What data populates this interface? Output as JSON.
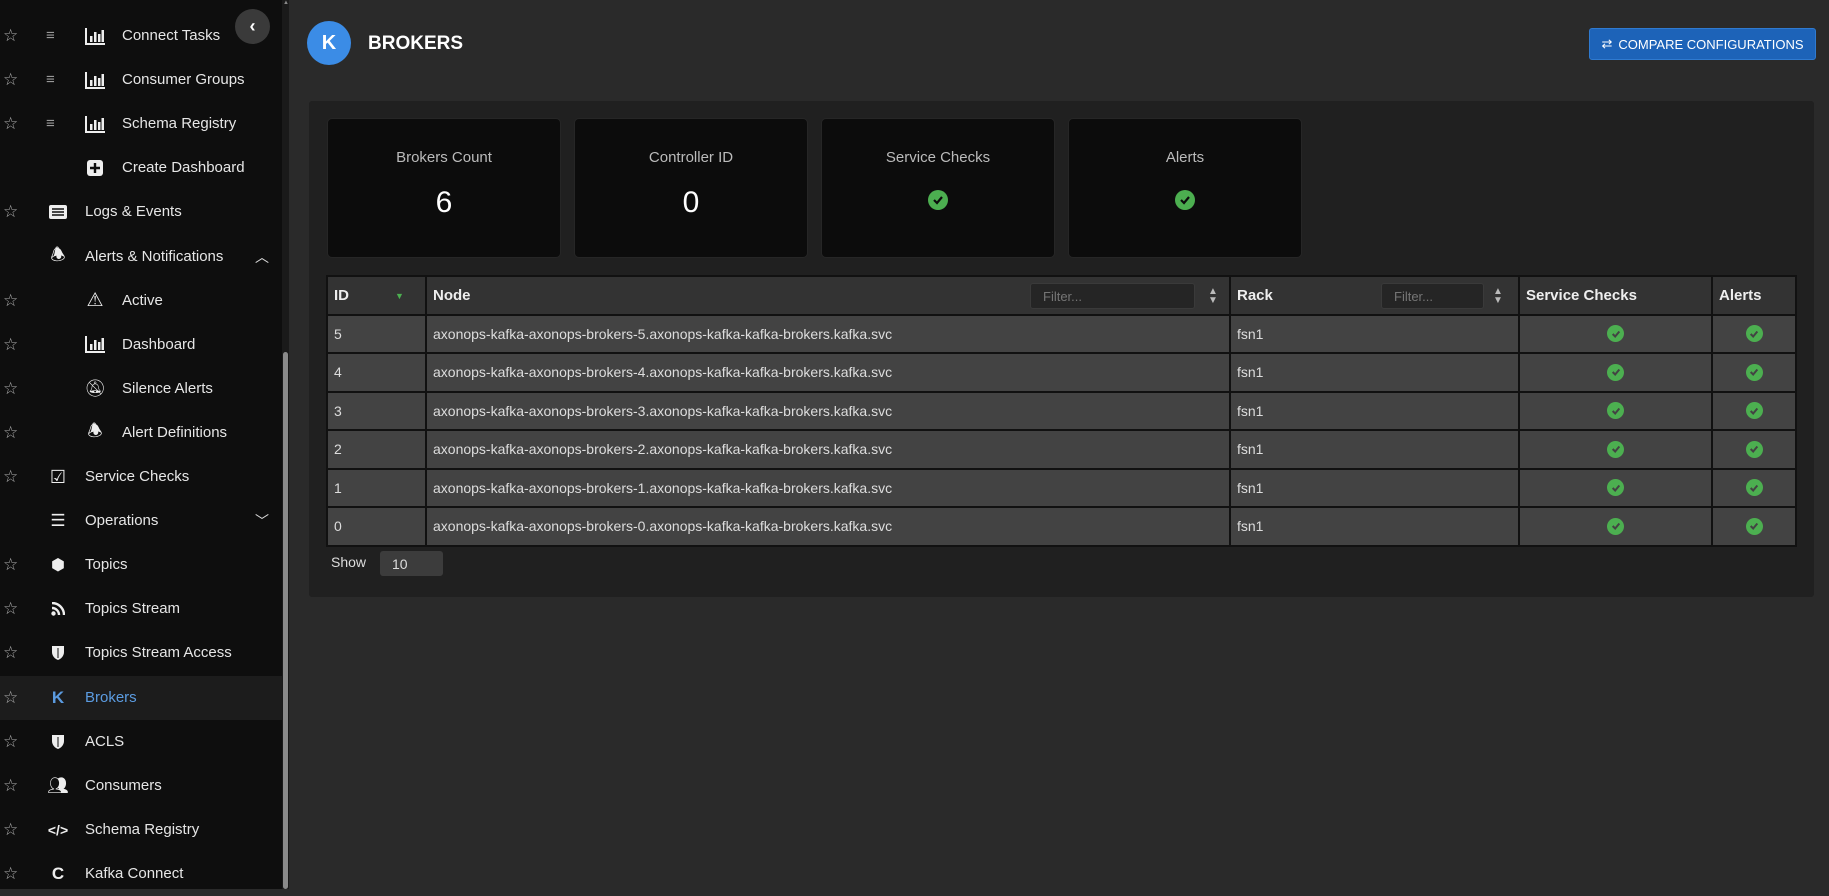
{
  "sidebar": {
    "items": [
      {
        "label": "Connect Tasks",
        "icon": "bar-chart-icon",
        "star": true,
        "drag": true,
        "level": 2
      },
      {
        "label": "Consumer Groups",
        "icon": "bar-chart-icon",
        "star": true,
        "drag": true,
        "level": 2
      },
      {
        "label": "Schema Registry",
        "icon": "bar-chart-icon",
        "star": true,
        "drag": true,
        "level": 2
      },
      {
        "label": "Create Dashboard",
        "icon": "plus-square-icon",
        "star": false,
        "drag": false,
        "level": 2
      },
      {
        "label": "Logs & Events",
        "icon": "list-icon",
        "star": true,
        "level": 1
      },
      {
        "label": "Alerts & Notifications",
        "icon": "bell-icon",
        "star": false,
        "level": 1,
        "chevron": "up"
      },
      {
        "label": "Active",
        "icon": "warning-icon",
        "star": true,
        "level": 2
      },
      {
        "label": "Dashboard",
        "icon": "bar-chart-icon",
        "star": true,
        "level": 2
      },
      {
        "label": "Silence Alerts",
        "icon": "bell-slash-icon",
        "star": true,
        "level": 2
      },
      {
        "label": "Alert Definitions",
        "icon": "bell-icon",
        "star": true,
        "level": 2
      },
      {
        "label": "Service Checks",
        "icon": "check-square-icon",
        "star": true,
        "level": 1
      },
      {
        "label": "Operations",
        "icon": "sliders-icon",
        "star": false,
        "level": 1,
        "chevron": "down"
      },
      {
        "label": "Topics",
        "icon": "cubes-icon",
        "star": true,
        "level": 1
      },
      {
        "label": "Topics Stream",
        "icon": "rss-icon",
        "star": true,
        "level": 1
      },
      {
        "label": "Topics Stream Access",
        "icon": "shield-icon",
        "star": true,
        "level": 1
      },
      {
        "label": "Brokers",
        "icon": "kafka-icon",
        "star": true,
        "level": 1,
        "active": true
      },
      {
        "label": "ACLS",
        "icon": "shield-icon",
        "star": true,
        "level": 1
      },
      {
        "label": "Consumers",
        "icon": "users-icon",
        "star": true,
        "level": 1
      },
      {
        "label": "Schema Registry",
        "icon": "code-icon",
        "star": true,
        "level": 1
      },
      {
        "label": "Kafka Connect",
        "icon": "connect-icon",
        "star": true,
        "level": 1
      }
    ]
  },
  "header": {
    "logo_letter": "K",
    "title": "BROKERS",
    "compare_label": "COMPARE CONFIGURATIONS"
  },
  "cards": [
    {
      "title": "Brokers Count",
      "value": "6"
    },
    {
      "title": "Controller ID",
      "value": "0"
    },
    {
      "title": "Service Checks",
      "status": "ok"
    },
    {
      "title": "Alerts",
      "status": "ok"
    }
  ],
  "table": {
    "headers": {
      "id": "ID",
      "node": "Node",
      "rack": "Rack",
      "service_checks": "Service Checks",
      "alerts": "Alerts"
    },
    "filter_placeholder": "Filter...",
    "rows": [
      {
        "id": "5",
        "node": "axonops-kafka-axonops-brokers-5.axonops-kafka-kafka-brokers.kafka.svc",
        "rack": "fsn1",
        "service_checks": "ok",
        "alerts": "ok"
      },
      {
        "id": "4",
        "node": "axonops-kafka-axonops-brokers-4.axonops-kafka-kafka-brokers.kafka.svc",
        "rack": "fsn1",
        "service_checks": "ok",
        "alerts": "ok"
      },
      {
        "id": "3",
        "node": "axonops-kafka-axonops-brokers-3.axonops-kafka-kafka-brokers.kafka.svc",
        "rack": "fsn1",
        "service_checks": "ok",
        "alerts": "ok"
      },
      {
        "id": "2",
        "node": "axonops-kafka-axonops-brokers-2.axonops-kafka-kafka-brokers.kafka.svc",
        "rack": "fsn1",
        "service_checks": "ok",
        "alerts": "ok"
      },
      {
        "id": "1",
        "node": "axonops-kafka-axonops-brokers-1.axonops-kafka-kafka-brokers.kafka.svc",
        "rack": "fsn1",
        "service_checks": "ok",
        "alerts": "ok"
      },
      {
        "id": "0",
        "node": "axonops-kafka-axonops-brokers-0.axonops-kafka-kafka-brokers.kafka.svc",
        "rack": "fsn1",
        "service_checks": "ok",
        "alerts": "ok"
      }
    ]
  },
  "pagination": {
    "show_label": "Show",
    "page_size": "10"
  },
  "colors": {
    "accent": "#3b8ce6",
    "ok": "#4caf50",
    "button": "#1d63b8"
  }
}
